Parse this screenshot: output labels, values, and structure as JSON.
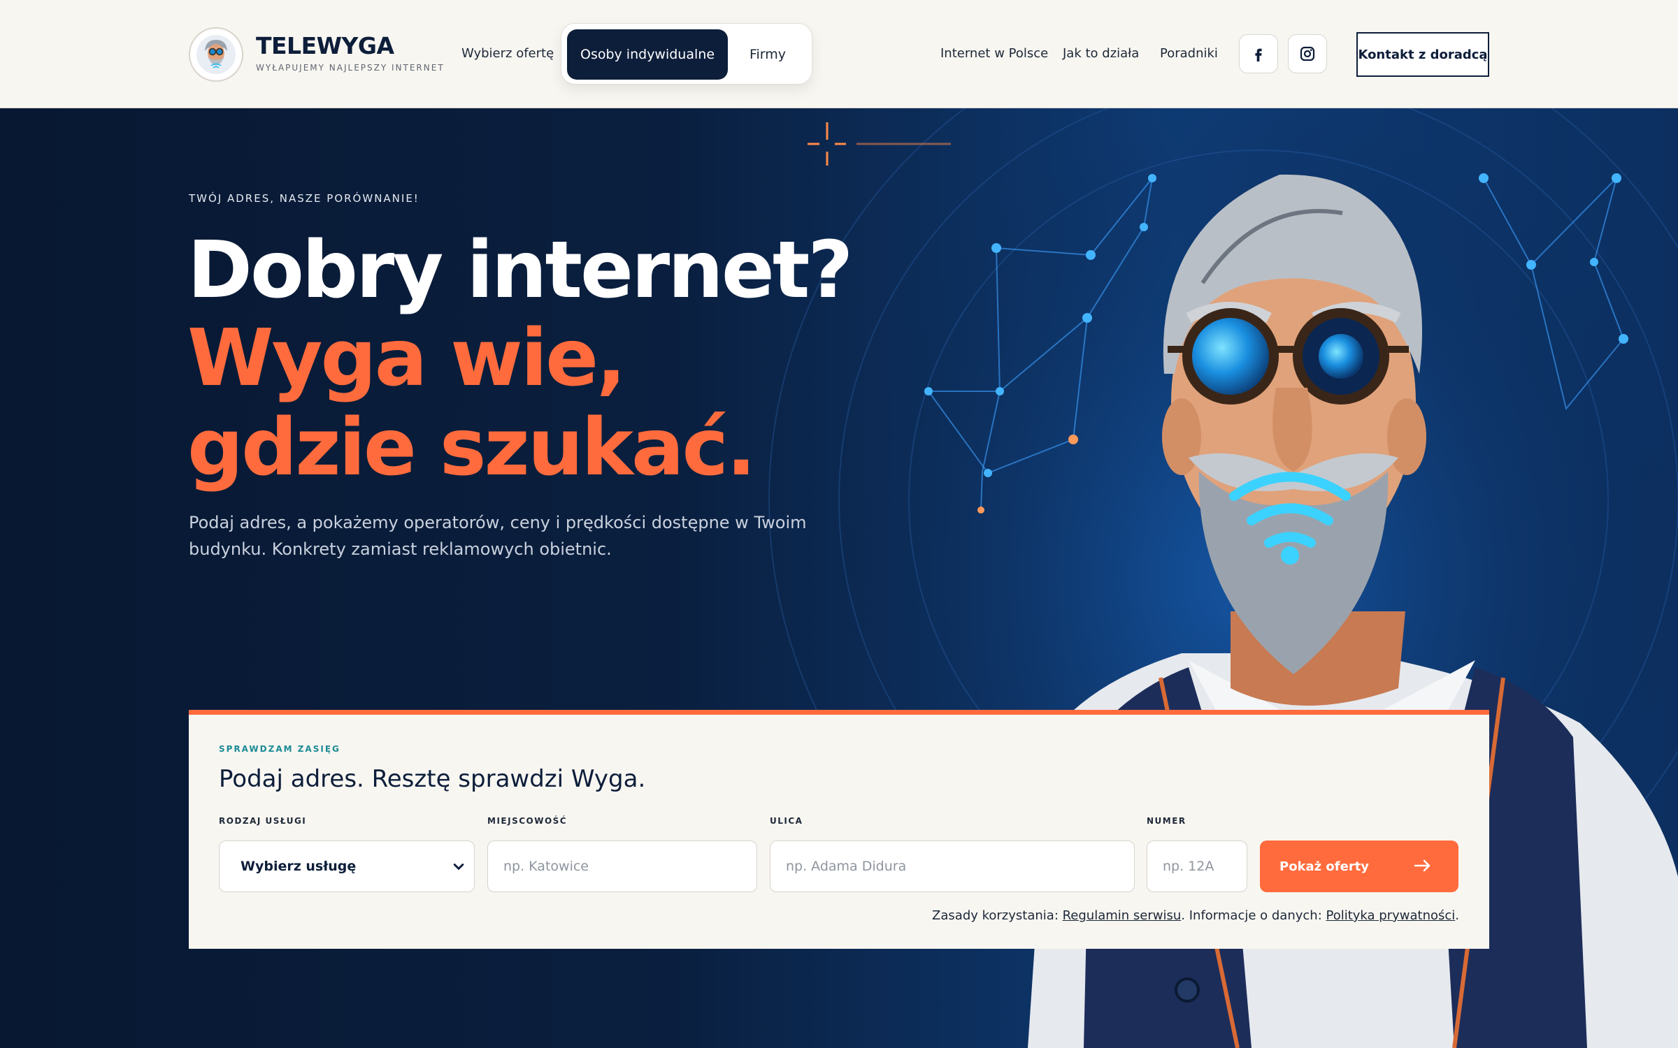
{
  "header": {
    "brand_name": "TELEWYGA",
    "brand_tagline": "WYŁAPUJEMY NAJLEPSZY INTERNET",
    "choose_offer": "Wybierz ofertę",
    "segments": [
      "Osoby indywidualne",
      "Firmy"
    ],
    "active_segment": "Osoby indywidualne",
    "nav_links": [
      "Internet w Polsce",
      "Jak to działa",
      "Poradniki"
    ],
    "social_icons": [
      "facebook-icon",
      "instagram-icon"
    ],
    "contact_button": "Kontakt z doradcą"
  },
  "hero": {
    "eyebrow": "TWÓJ ADRES, NASZE PORÓWNANIE!",
    "headline_white": "Dobry internet?",
    "headline_orange": "Wyga wie, gdzie szukać.",
    "description": "Podaj adres, a pokażemy operatorów, ceny i prędkości dostępne w Twoim budynku. Konkrety zamiast reklamowych obietnic."
  },
  "search": {
    "eyebrow": "SPRAWDZAM ZASIĘG",
    "title": "Podaj adres. Resztę sprawdzi Wyga.",
    "service_label": "RODZAJ USŁUGI",
    "service_value": "Wybierz usługę",
    "city_label": "MIEJSCOWOŚĆ",
    "city_placeholder": "np. Katowice",
    "street_label": "ULICA",
    "street_placeholder": "np. Adama Didura",
    "number_label": "NUMER",
    "number_placeholder": "np. 12A",
    "submit_label": "Pokaż oferty",
    "legal_prefix": "Zasady korzystania: ",
    "legal_terms": "Regulamin serwisu",
    "legal_middle": ". Informacje o danych: ",
    "legal_privacy": "Polityka prywatności",
    "legal_suffix": "."
  },
  "colors": {
    "navy": "#0d1e3a",
    "accent_orange": "#ff6b3d",
    "teal": "#1b8a95",
    "cream": "#f8f6f1"
  }
}
